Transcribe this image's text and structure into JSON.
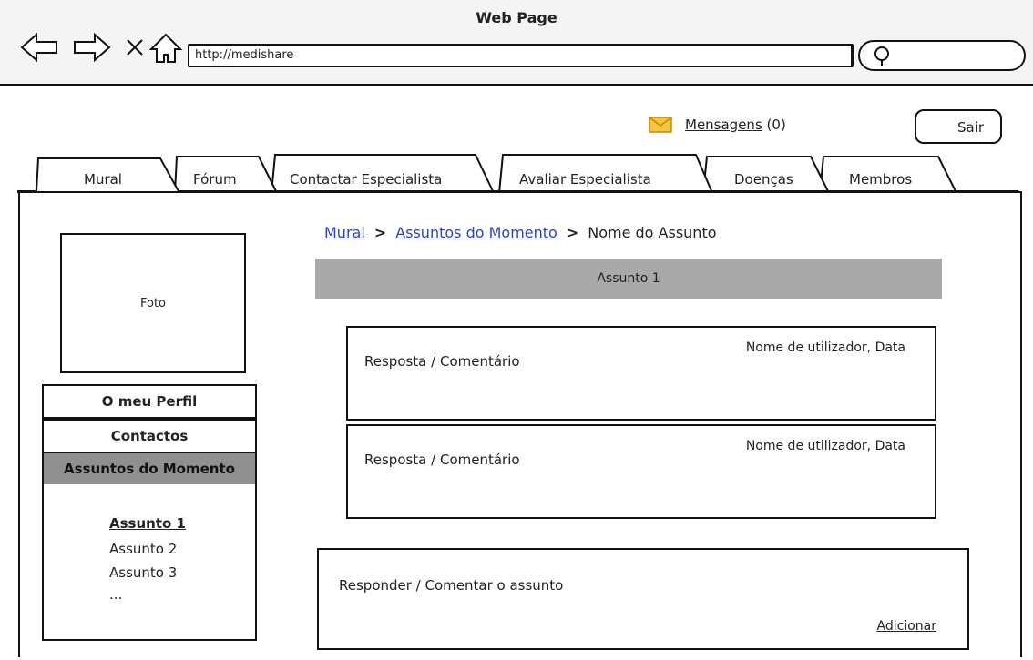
{
  "browser": {
    "title": "Web Page",
    "url": "http://medishare",
    "icons": [
      "back-arrow-icon",
      "forward-arrow-icon",
      "close-icon",
      "home-icon",
      "search-icon"
    ]
  },
  "header": {
    "messages_label": "Mensagens",
    "messages_count": "(0)",
    "logout_label": "Sair"
  },
  "tabs": [
    {
      "label": "Mural"
    },
    {
      "label": "Fórum"
    },
    {
      "label": "Contactar Especialista"
    },
    {
      "label": "Avaliar Especialista"
    },
    {
      "label": "Doenças"
    },
    {
      "label": "Membros"
    }
  ],
  "breadcrumb": {
    "item1": "Mural",
    "item2": "Assuntos do Momento",
    "current": "Nome do Assunto",
    "separator": ">"
  },
  "topic_title": "Assunto 1",
  "sidebar": {
    "photo_label": "Foto",
    "menu": [
      {
        "label": "O meu Perfil"
      },
      {
        "label": "Contactos"
      },
      {
        "label": "Assuntos do Momento"
      }
    ],
    "topics": [
      {
        "label": "Assunto 1"
      },
      {
        "label": "Assunto 2"
      },
      {
        "label": "Assunto 3"
      },
      {
        "label": "..."
      }
    ]
  },
  "replies": [
    {
      "text": "Resposta / Comentário",
      "meta": "Nome de utilizador, Data"
    },
    {
      "text": "Resposta / Comentário",
      "meta": "Nome de utilizador, Data"
    }
  ],
  "respond": {
    "placeholder": "Responder / Comentar o assunto",
    "add_label": "Adicionar"
  }
}
